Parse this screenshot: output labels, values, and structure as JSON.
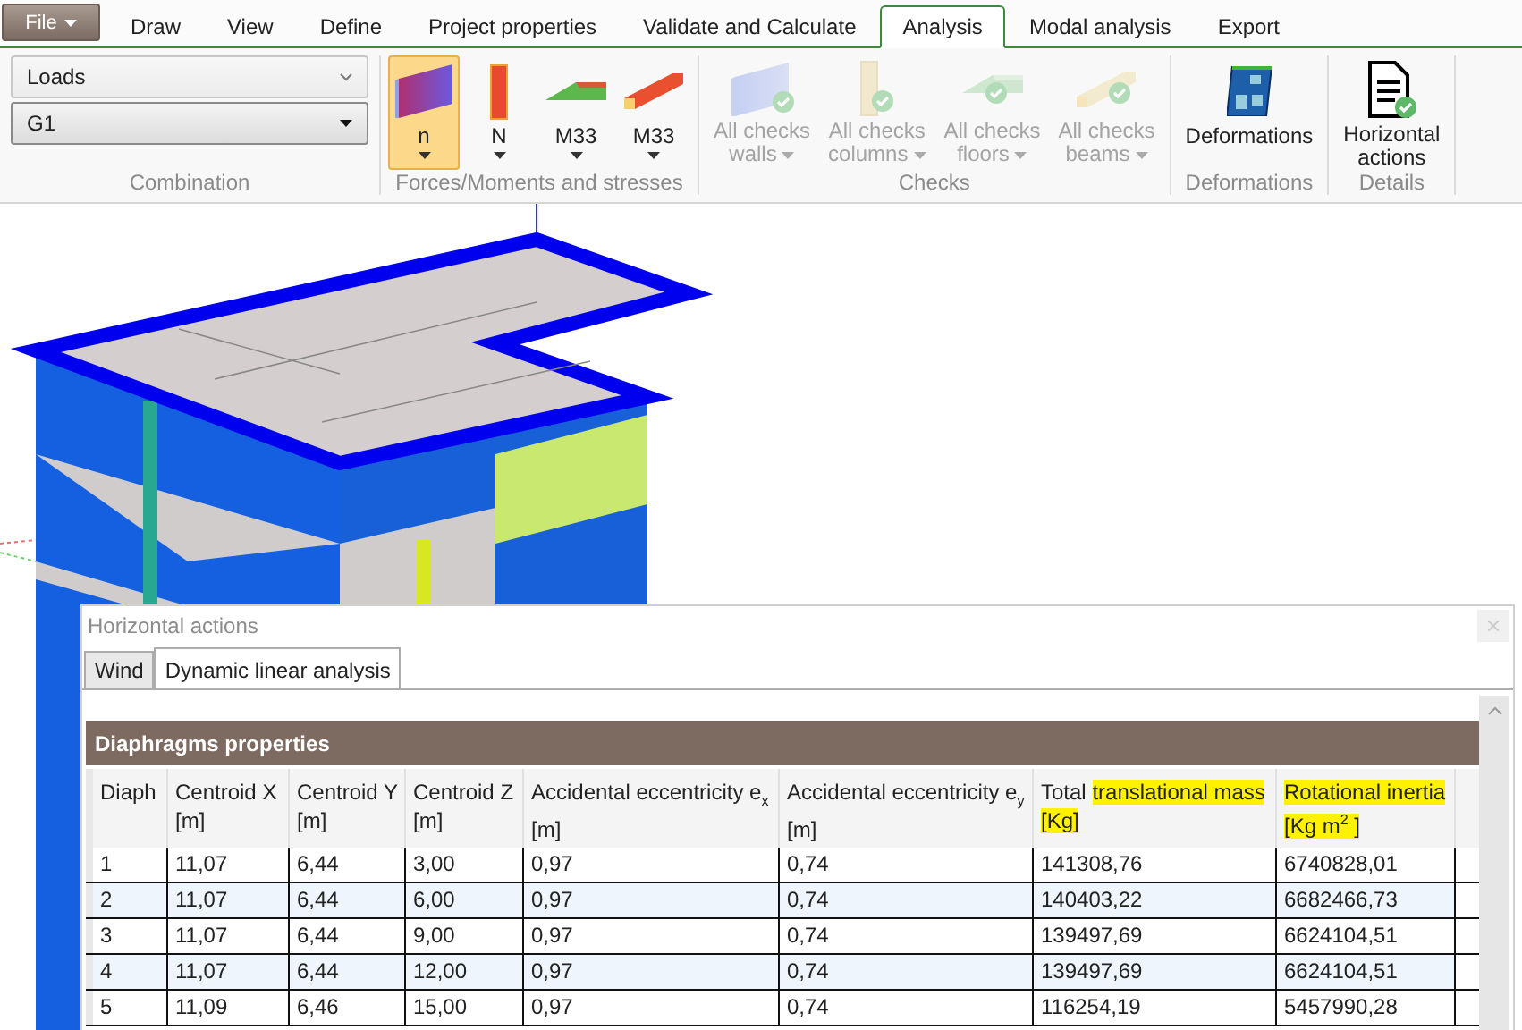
{
  "menu_tabs": [
    {
      "label": "File",
      "kind": "file",
      "selected": false
    },
    {
      "label": "Draw",
      "kind": "tab",
      "selected": false
    },
    {
      "label": "View",
      "kind": "tab",
      "selected": false
    },
    {
      "label": "Define",
      "kind": "tab",
      "selected": false
    },
    {
      "label": "Project properties",
      "kind": "tab",
      "selected": false
    },
    {
      "label": "Validate and Calculate",
      "kind": "tab",
      "selected": false
    },
    {
      "label": "Analysis",
      "kind": "tab",
      "selected": true
    },
    {
      "label": "Modal analysis",
      "kind": "tab",
      "selected": false
    },
    {
      "label": "Export",
      "kind": "tab",
      "selected": false
    }
  ],
  "ribbon": {
    "groups": [
      {
        "label": "Combination",
        "kind": "combos",
        "combos": [
          {
            "value": "Loads",
            "kind": "light"
          },
          {
            "value": "G1",
            "kind": "solid"
          }
        ]
      },
      {
        "label": "Forces/Moments and stresses",
        "kind": "buttons",
        "buttons": [
          {
            "lines": [
              "n"
            ],
            "kind": "wall",
            "dropdown": true,
            "selected": true,
            "disabled": false
          },
          {
            "lines": [
              "N"
            ],
            "kind": "column",
            "dropdown": true,
            "selected": false,
            "disabled": false
          },
          {
            "lines": [
              "M33"
            ],
            "kind": "slab",
            "dropdown": true,
            "selected": false,
            "disabled": false
          },
          {
            "lines": [
              "M33"
            ],
            "kind": "beam",
            "dropdown": true,
            "selected": false,
            "disabled": false
          }
        ]
      },
      {
        "label": "Checks",
        "kind": "buttons",
        "buttons": [
          {
            "lines": [
              "All checks",
              "walls"
            ],
            "kind": "wall-check",
            "dropdown": true,
            "selected": false,
            "disabled": true
          },
          {
            "lines": [
              "All checks",
              "columns"
            ],
            "kind": "column-check",
            "dropdown": true,
            "selected": false,
            "disabled": true
          },
          {
            "lines": [
              "All checks",
              "floors"
            ],
            "kind": "slab-check",
            "dropdown": true,
            "selected": false,
            "disabled": true
          },
          {
            "lines": [
              "All checks",
              "beams"
            ],
            "kind": "beam-check",
            "dropdown": true,
            "selected": false,
            "disabled": true
          }
        ]
      },
      {
        "label": "Deformations",
        "kind": "buttons",
        "buttons": [
          {
            "lines": [
              "Deformations"
            ],
            "kind": "deformed",
            "dropdown": false,
            "selected": false,
            "disabled": false
          }
        ]
      },
      {
        "label": "Details",
        "kind": "buttons",
        "buttons": [
          {
            "lines": [
              "Horizontal",
              "actions"
            ],
            "kind": "document",
            "dropdown": false,
            "selected": false,
            "disabled": false
          }
        ]
      }
    ]
  },
  "dialog": {
    "title": "Horizontal actions",
    "tabs": [
      {
        "label": "Wind",
        "selected": false
      },
      {
        "label": "Dynamic linear analysis",
        "selected": true
      }
    ],
    "section_title": "Diaphragms properties",
    "table": {
      "columns": [
        {
          "label": "Diaph"
        },
        {
          "label": "Centroid X",
          "unit": "[m]"
        },
        {
          "label": "Centroid Y",
          "unit": "[m]"
        },
        {
          "label": "Centroid Z",
          "unit": "[m]"
        },
        {
          "label": "Accidental eccentricity e$_{x}$",
          "unit": "[m]"
        },
        {
          "label": "Accidental eccentricity e$_{y}$",
          "unit": "[m]"
        },
        {
          "prefix": "Total",
          "label": "translational mass",
          "highlighted": true,
          "unit": "[Kg]"
        },
        {
          "label": "Rotational inertia",
          "highlighted": true,
          "unit": "[Kg m$^{2}$ ]"
        }
      ],
      "rows": [
        [
          "1",
          "11,07",
          "6,44",
          "3,00",
          "0,97",
          "0,74",
          "141308,76",
          "6740828,01"
        ],
        [
          "2",
          "11,07",
          "6,44",
          "6,00",
          "0,97",
          "0,74",
          "140403,22",
          "6682466,73"
        ],
        [
          "3",
          "11,07",
          "6,44",
          "9,00",
          "0,97",
          "0,74",
          "139497,69",
          "6624104,51"
        ],
        [
          "4",
          "11,07",
          "6,44",
          "12,00",
          "0,97",
          "0,74",
          "139497,69",
          "6624104,51"
        ],
        [
          "5",
          "11,09",
          "6,46",
          "15,00",
          "0,97",
          "0,74",
          "116254,19",
          "5457990,28"
        ]
      ]
    }
  }
}
